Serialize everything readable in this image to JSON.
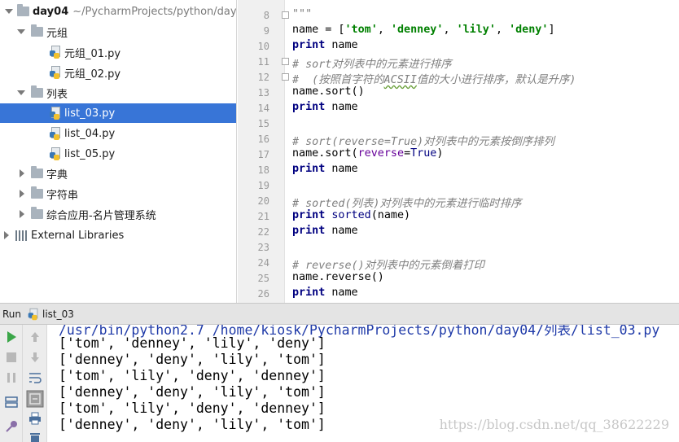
{
  "tree": {
    "root": {
      "name": "day04",
      "path": "~/PycharmProjects/python/day"
    },
    "folders": {
      "tuple": {
        "name": "元组",
        "files": [
          "元组_01.py",
          "元组_02.py"
        ]
      },
      "list": {
        "name": "列表",
        "files": [
          "list_03.py",
          "list_04.py",
          "list_05.py"
        ]
      },
      "dict": {
        "name": "字典"
      },
      "string": {
        "name": "字符串"
      },
      "app": {
        "name": "综合应用-名片管理系统"
      }
    },
    "external": "External Libraries"
  },
  "editor": {
    "line_numbers": [
      "8",
      "9",
      "10",
      "11",
      "12",
      "13",
      "14",
      "15",
      "16",
      "17",
      "18",
      "19",
      "20",
      "21",
      "22",
      "23",
      "24",
      "25",
      "26"
    ],
    "tokens": {
      "docstring_end": "\"\"\"",
      "name": "name",
      "assign": " = [",
      "tom": "'tom'",
      "denney": "'denney'",
      "lily": "'lily'",
      "deny": "'deny'",
      "comma": ", ",
      "close_bracket": "]",
      "print": "print",
      "c11": "# sort对列表中的元素进行排序",
      "c12_a": "#  (按照首字符的",
      "c12_b": "ACSII",
      "c12_c": "值的大小进行排序，默认是升序)",
      "sort_call": "name.sort()",
      "c16": "# sort(reverse=True)对列表中的元素按倒序排列",
      "sort_open": "name.sort(",
      "reverse_kw": "reverse",
      "eq": "=",
      "true": "True",
      "close_paren": ")",
      "c20": "# sorted(列表)对列表中的元素进行临时排序",
      "sorted": "sorted",
      "sorted_arg": "(name)",
      "c24": "# reverse()对列表中的元素倒着打印",
      "reverse_call": "name.reverse()"
    }
  },
  "run": {
    "title": "Run",
    "tab": "list_03",
    "console": [
      "/usr/bin/python2.7 /home/kiosk/PycharmProjects/python/day04/列表/list_03.py",
      "['tom', 'denney', 'lily', 'deny']",
      "['denney', 'deny', 'lily', 'tom']",
      "['tom', 'lily', 'deny', 'denney']",
      "['denney', 'deny', 'lily', 'tom']",
      "['tom', 'lily', 'deny', 'denney']",
      "['denney', 'deny', 'lily', 'tom']"
    ],
    "watermark": "https://blog.csdn.net/qq_38622229"
  },
  "icons": [
    "folder-icon",
    "python-file-icon",
    "library-icon",
    "run-icon",
    "stop-icon",
    "pause-icon",
    "up-arrow-icon",
    "down-arrow-icon",
    "wrap-icon",
    "layout-icon",
    "scroll-icon",
    "print-icon",
    "trash-icon",
    "pin-icon"
  ],
  "colors": {
    "selection": "#3875d7",
    "keyword": "#000080",
    "string": "#008000",
    "comment": "#808080",
    "run_green": "#3aa648"
  }
}
